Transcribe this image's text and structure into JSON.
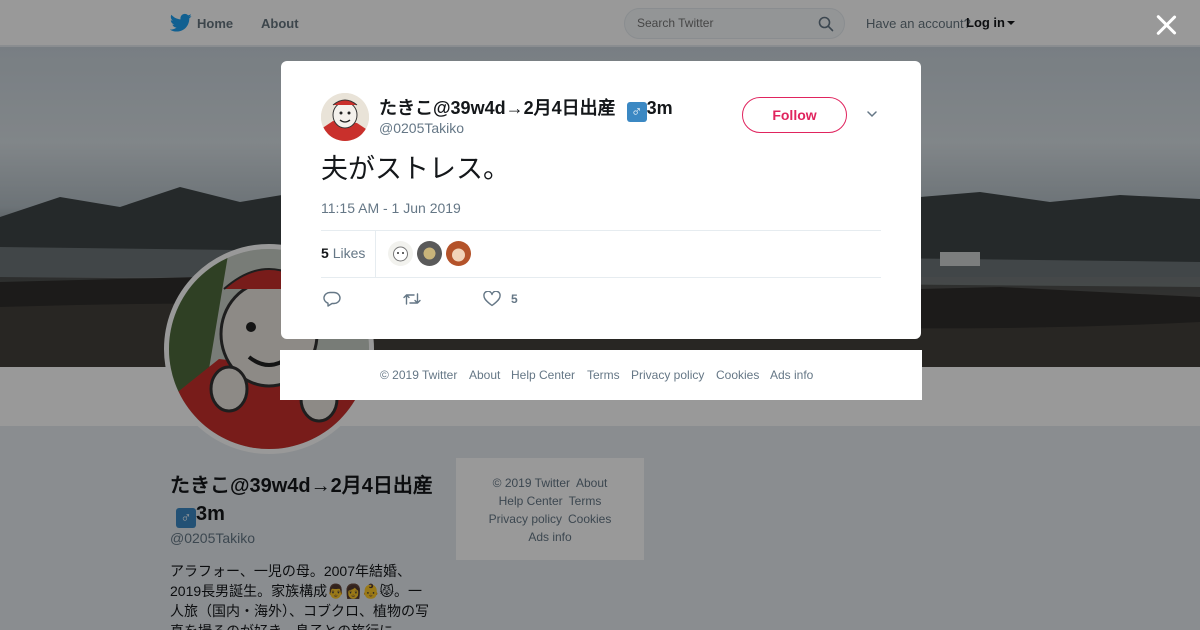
{
  "nav": {
    "home_label": "Home",
    "about_label": "About",
    "search_placeholder": "Search Twitter",
    "account_prompt": "Have an account?",
    "login_label": "Log in"
  },
  "profile": {
    "name": "たきこ@39w4d→2月4日出産",
    "name_suffix": "3m",
    "gender_symbol": "♂",
    "handle": "@0205Takiko",
    "bio": "アラフォー、一児の母。2007年結婚、2019長男誕生。家族構成👨👩👶😾。一人旅（国内・海外）、コブクロ、植物の写真を撮るのが好き。息子との旅行に"
  },
  "side_footer": {
    "copyright": "© 2019 Twitter",
    "about": "About",
    "help_center": "Help Center",
    "terms": "Terms",
    "privacy_policy": "Privacy policy",
    "cookies": "Cookies",
    "ads_info": "Ads info"
  },
  "tweet": {
    "author_name": "たきこ@39w4d→2月4日出産",
    "author_name_suffix": "3m",
    "gender_symbol": "♂",
    "author_handle": "@0205Takiko",
    "follow_label": "Follow",
    "text": "夫がストレス。",
    "timestamp": "11:15 AM - 1 Jun 2019",
    "likes_count": "5",
    "likes_label": "Likes",
    "heart_count": "5"
  },
  "modal_footer": {
    "copyright": "© 2019 Twitter",
    "about": "About",
    "help_center": "Help Center",
    "terms": "Terms",
    "privacy_policy": "Privacy policy",
    "cookies": "Cookies",
    "ads_info": "Ads info"
  },
  "colors": {
    "twitter_blue": "#1da1f2",
    "follow_pink": "#e0245e",
    "muted_text": "#657786",
    "page_bg": "#e6ecf0"
  },
  "icons": [
    "twitter-bird-icon",
    "search-icon",
    "caret-down-icon",
    "close-icon",
    "chevron-down-icon",
    "reply-icon",
    "retweet-icon",
    "heart-icon"
  ]
}
